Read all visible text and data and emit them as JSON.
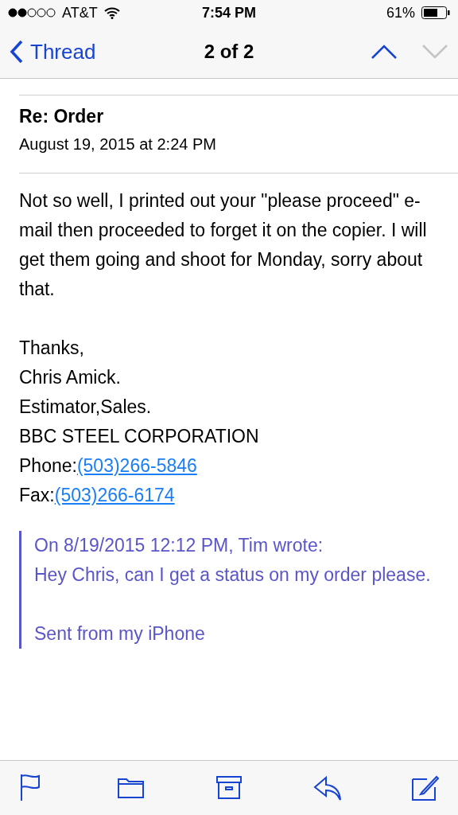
{
  "status_bar": {
    "carrier": "AT&T",
    "time": "7:54 PM",
    "battery": "61%"
  },
  "nav": {
    "back": "Thread",
    "title": "2 of 2",
    "previous": {
      "disabled": false
    },
    "next": {
      "disabled": true
    }
  },
  "message": {
    "subject": "Re: Order",
    "date": "August 19, 2015 at 2:24 PM",
    "body": "Not so well, I printed out your \"please proceed\" e-mail then proceeded to forget it on the copier. I will get them going and shoot for Monday, sorry about that.",
    "signature": [
      {
        "kind": "text",
        "text": "Thanks,"
      },
      {
        "kind": "text",
        "text": "Chris Amick."
      },
      {
        "kind": "text",
        "text": "Estimator,Sales."
      },
      {
        "kind": "text",
        "text": "BBC STEEL CORPORATION"
      },
      {
        "kind": "link",
        "label": "Phone:",
        "link": "(503)266-5846"
      },
      {
        "kind": "link",
        "label": "Fax:",
        "link": "(503)266-6174"
      }
    ],
    "quote": {
      "header": "On 8/19/2015 12:12 PM, Tim wrote:",
      "body": "Hey Chris, can I get a status on my order please.",
      "footer": "Sent from my iPhone"
    }
  },
  "toolbar": [
    {
      "kind": "flag"
    },
    {
      "kind": "folder"
    },
    {
      "kind": "archive"
    },
    {
      "kind": "reply"
    },
    {
      "kind": "compose"
    }
  ]
}
